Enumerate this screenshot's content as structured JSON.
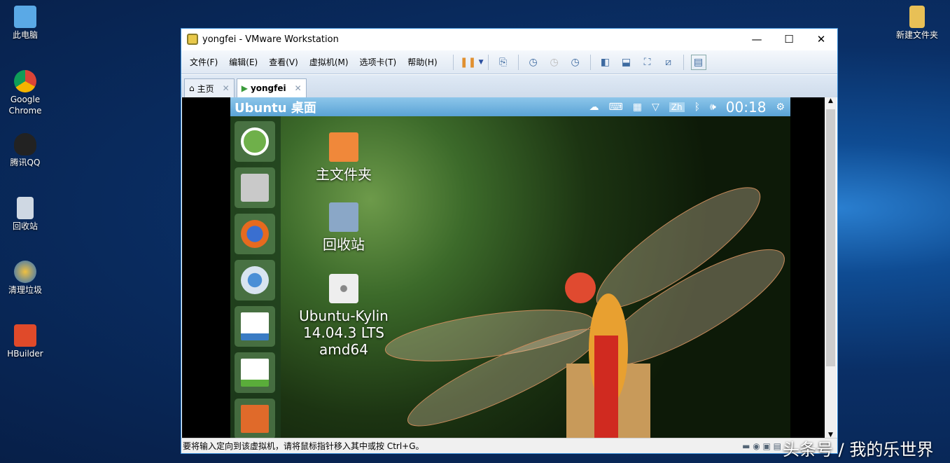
{
  "desktop": {
    "left_icons": [
      {
        "label": "此电脑",
        "color": "#5aa9e6"
      },
      {
        "label": "Google Chrome",
        "color": "#db4437"
      },
      {
        "label": "腾讯QQ",
        "color": "#222222"
      },
      {
        "label": "回收站",
        "color": "#cfd8e3"
      },
      {
        "label": "清理垃圾",
        "color": "#f0a020"
      },
      {
        "label": "HBuilder",
        "color": "#e04a2a"
      }
    ],
    "right_icons": [
      {
        "label": "新建文件夹",
        "color": "#e8c056"
      }
    ]
  },
  "window": {
    "title": "yongfei - VMware Workstation",
    "controls": {
      "minimize": "—",
      "maximize": "☐",
      "close": "✕"
    },
    "menu": [
      "文件(F)",
      "编辑(E)",
      "查看(V)",
      "虚拟机(M)",
      "选项卡(T)",
      "帮助(H)"
    ],
    "tabs": [
      {
        "label": "主页",
        "icon": "home-icon",
        "active": false
      },
      {
        "label": "yongfei",
        "icon": "vm-icon",
        "active": true
      }
    ],
    "status": "要将输入定向到该虚拟机，请将鼠标指针移入其中或按 Ctrl+G。"
  },
  "ubuntu": {
    "title": "Ubuntu 桌面",
    "clock": "00:18",
    "ime": "Zh",
    "launcher": [
      {
        "name": "ubuntu-dash",
        "color": "#6fb04a"
      },
      {
        "name": "file-cabinet",
        "color": "#c9c9c9"
      },
      {
        "name": "firefox",
        "color": "#e66a1f"
      },
      {
        "name": "chromium",
        "color": "#4a8fd6"
      },
      {
        "name": "writer",
        "color": "#3a7cc4"
      },
      {
        "name": "calc",
        "color": "#5aad3a"
      },
      {
        "name": "impress",
        "color": "#e06a2a"
      }
    ],
    "desktop_icons": [
      {
        "label": "主文件夹",
        "color": "#f0883a"
      },
      {
        "label": "回收站",
        "color": "#8aa7c7"
      },
      {
        "label": "Ubuntu-Kylin 14.04.3 LTS amd64",
        "color": "#d8d8d8"
      }
    ]
  },
  "watermark": "头条号 / 我的乐世界"
}
